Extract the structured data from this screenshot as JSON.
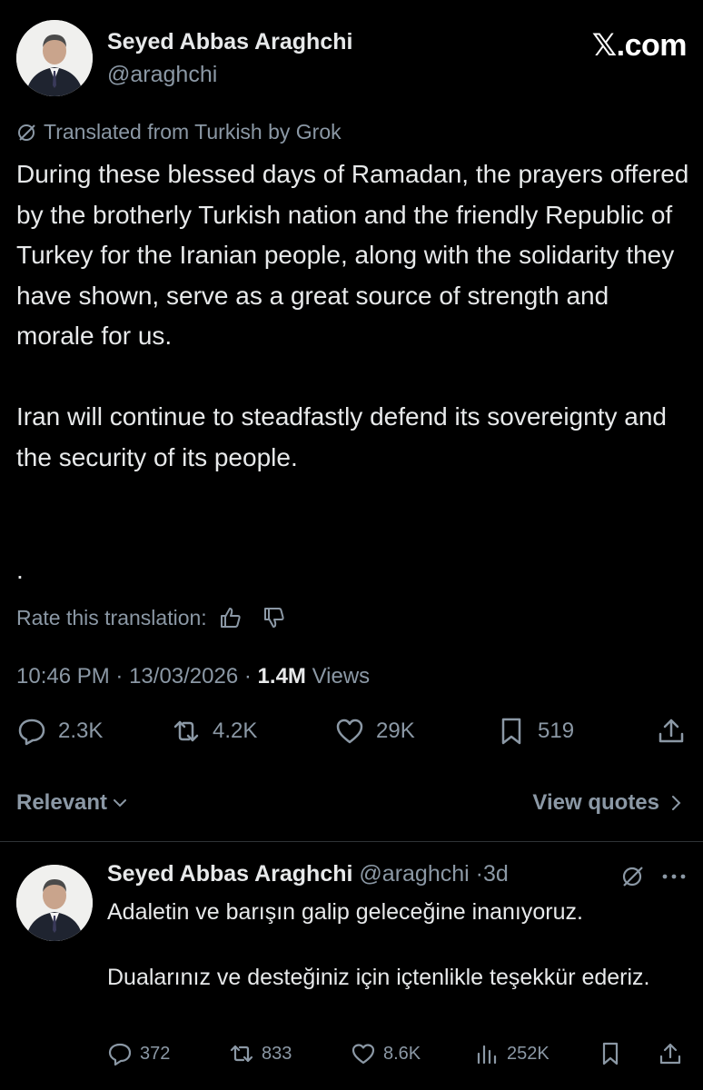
{
  "header": {
    "name": "Seyed Abbas Araghchi",
    "handle": "@araghchi",
    "site": "𝕏.com"
  },
  "translation": {
    "label": "Translated from Turkish by Grok",
    "rate_label": "Rate this translation:"
  },
  "tweet": {
    "paragraph1": "During these blessed days of Ramadan, the prayers offered by the brotherly Turkish nation and the friendly Republic of Turkey for the Iranian people, along with the solidarity they have shown, serve as a great source of strength and morale for us.",
    "paragraph2": "Iran will continue to steadfastly defend its sovereignty and the security of its people.",
    "trailing": ".",
    "time": "10:46 PM",
    "date": "13/03/2026",
    "views_count": "1.4M",
    "views_label": "Views",
    "replies": "2.3K",
    "reposts": "4.2K",
    "likes": "29K",
    "bookmarks": "519"
  },
  "sort": {
    "relevant_label": "Relevant",
    "view_quotes_label": "View quotes"
  },
  "reply": {
    "name": "Seyed Abbas Araghchi",
    "handle": "@araghchi",
    "age": "3d",
    "paragraph1": "Adaletin ve barışın galip geleceğine inanıyoruz.",
    "paragraph2": "Dualarınız ve desteğiniz için içtenlikle teşekkür ederiz.",
    "replies": "372",
    "reposts": "833",
    "likes": "8.6K",
    "views": "252K"
  },
  "colors": {
    "background": "#000000",
    "text": "#e7e9ea",
    "secondary": "#8b98a5",
    "divider": "#2f3336"
  },
  "icons": [
    "grok-icon",
    "thumbs-up-icon",
    "thumbs-down-icon",
    "reply-icon",
    "repost-icon",
    "like-icon",
    "bookmark-icon",
    "share-icon",
    "chevron-down-icon",
    "chevron-right-icon",
    "more-icon",
    "views-icon"
  ]
}
